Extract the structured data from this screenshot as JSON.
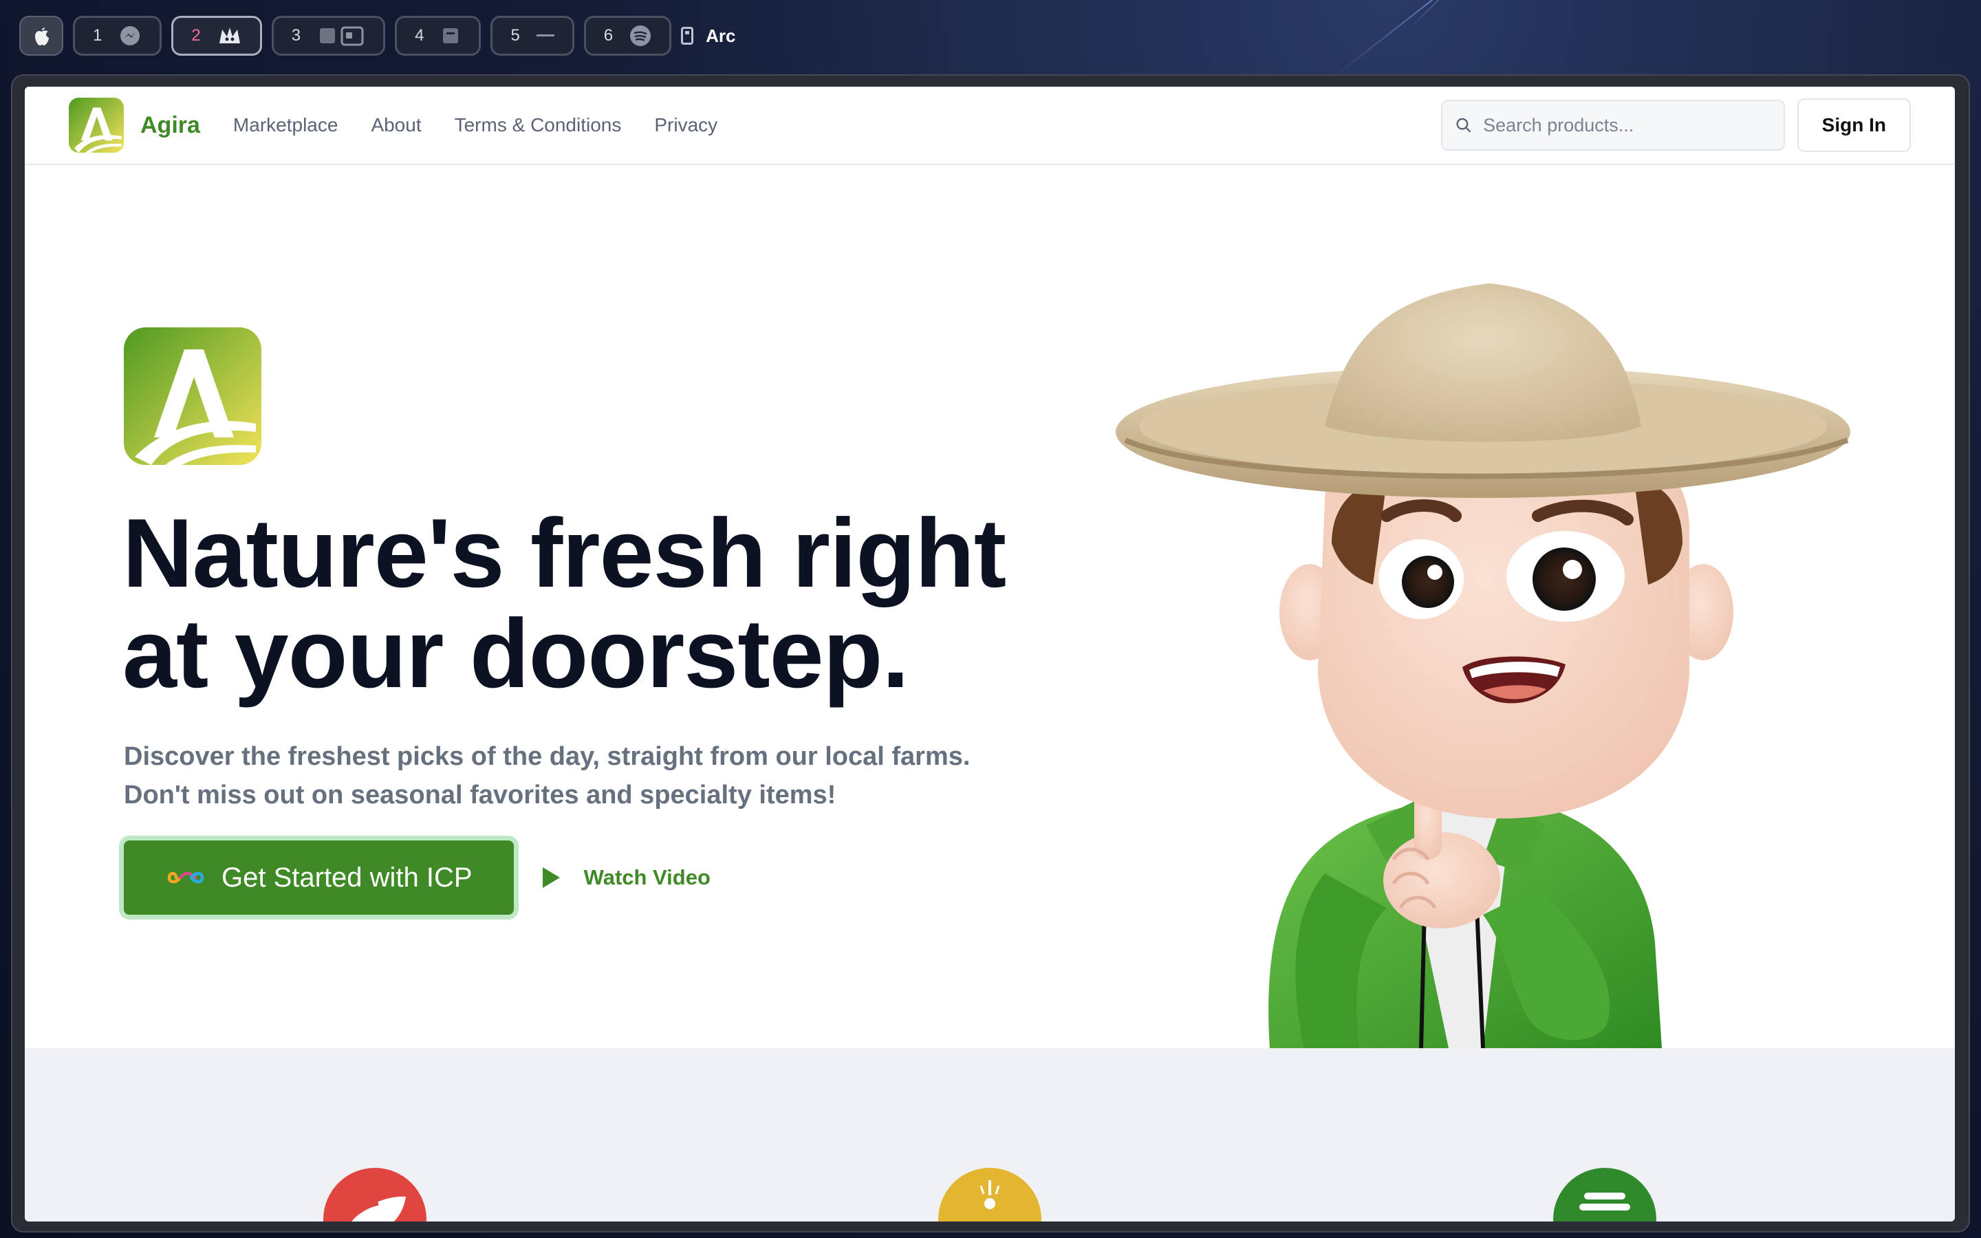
{
  "menubar": {
    "workspaces": [
      {
        "num": "1",
        "icon": "messenger-icon"
      },
      {
        "num": "2",
        "icon": "crown-icon"
      },
      {
        "num": "3",
        "icon": "apps-icon"
      },
      {
        "num": "4",
        "icon": "app-icon"
      },
      {
        "num": "5",
        "icon": "dash-icon"
      },
      {
        "num": "6",
        "icon": "spotify-icon"
      }
    ],
    "active_app": "Arc"
  },
  "nav": {
    "brand": "Agira",
    "links": [
      "Marketplace",
      "About",
      "Terms & Conditions",
      "Privacy"
    ],
    "search_placeholder": "Search products...",
    "signin": "Sign In"
  },
  "hero": {
    "headline_line1": "Nature's fresh right",
    "headline_line2": "at your doorstep.",
    "sub_line1": "Discover the freshest picks of the day, straight from our local farms.",
    "sub_line2": "Don't miss out on seasonal favorites and specialty items!",
    "cta": "Get Started with ICP",
    "watch": "Watch Video"
  },
  "colors": {
    "brand_green": "#3f8a26",
    "feature_red": "#e0453f",
    "feature_yellow": "#e3b531",
    "feature_green": "#2f8a2c"
  }
}
